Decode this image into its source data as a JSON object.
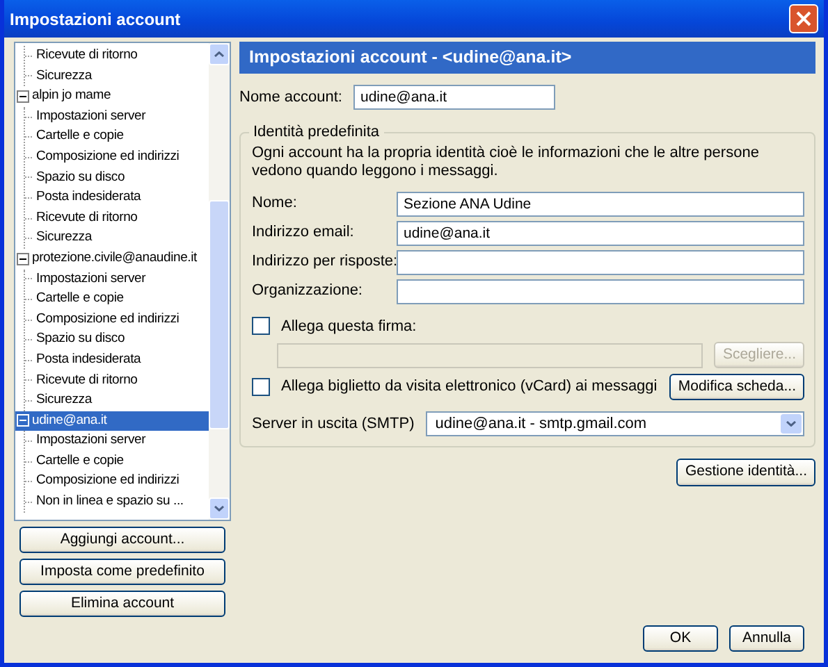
{
  "window": {
    "title": "Impostazioni account"
  },
  "tree": [
    {
      "children": [
        {
          "label": "Ricevute di ritorno",
          "selected": false
        },
        {
          "label": "Sicurezza",
          "selected": false
        }
      ]
    },
    {
      "label": "alpin jo mame",
      "expanded": true,
      "selected": false,
      "children": [
        {
          "label": "Impostazioni server",
          "selected": false
        },
        {
          "label": "Cartelle e copie",
          "selected": false
        },
        {
          "label": "Composizione ed indirizzi",
          "selected": false
        },
        {
          "label": "Spazio su disco",
          "selected": false
        },
        {
          "label": "Posta indesiderata",
          "selected": false
        },
        {
          "label": "Ricevute di ritorno",
          "selected": false
        },
        {
          "label": "Sicurezza",
          "selected": false
        }
      ]
    },
    {
      "label": "protezione.civile@anaudine.it",
      "expanded": true,
      "selected": false,
      "children": [
        {
          "label": "Impostazioni server",
          "selected": false
        },
        {
          "label": "Cartelle e copie",
          "selected": false
        },
        {
          "label": "Composizione ed indirizzi",
          "selected": false
        },
        {
          "label": "Spazio su disco",
          "selected": false
        },
        {
          "label": "Posta indesiderata",
          "selected": false
        },
        {
          "label": "Ricevute di ritorno",
          "selected": false
        },
        {
          "label": "Sicurezza",
          "selected": false
        }
      ]
    },
    {
      "label": "udine@ana.it",
      "expanded": true,
      "selected": true,
      "children": [
        {
          "label": "Impostazioni server",
          "selected": false
        },
        {
          "label": "Cartelle e copie",
          "selected": false
        },
        {
          "label": "Composizione ed indirizzi",
          "selected": false
        },
        {
          "label": "Non in linea e spazio su ...",
          "selected": false
        }
      ]
    }
  ],
  "account_buttons": [
    "Aggiungi account...",
    "Imposta come predefinito",
    "Elimina account"
  ],
  "panel": {
    "header": "Impostazioni account - <udine@ana.it>",
    "account_name": {
      "label": "Nome account:",
      "value": "udine@ana.it"
    },
    "identity": {
      "legend": "Identità predefinita",
      "description": "Ogni account ha la propria identità cioè le informazioni che le altre persone vedono quando leggono i messaggi.",
      "fields": [
        {
          "label": "Nome:",
          "value": "Sezione ANA Udine"
        },
        {
          "label": "Indirizzo email:",
          "value": "udine@ana.it"
        },
        {
          "label": "Indirizzo per risposte:"
        },
        {
          "label": "Organizzazione:"
        }
      ],
      "signature": {
        "label": "Allega questa firma:",
        "checked": false
      },
      "signature_file": {
        "disabled": true
      },
      "choose_button": {
        "label": "Scegliere...",
        "disabled": true
      },
      "vcard": {
        "label": "Allega biglietto da visita elettronico (vCard) ai messaggi",
        "checked": false
      },
      "edit_card_button": "Modifica scheda...",
      "smtp": {
        "label": "Server in uscita (SMTP)",
        "value": "udine@ana.it - smtp.gmail.com"
      }
    },
    "identities_button": "Gestione identità..."
  },
  "dialog_buttons": [
    "OK",
    "Annulla"
  ]
}
